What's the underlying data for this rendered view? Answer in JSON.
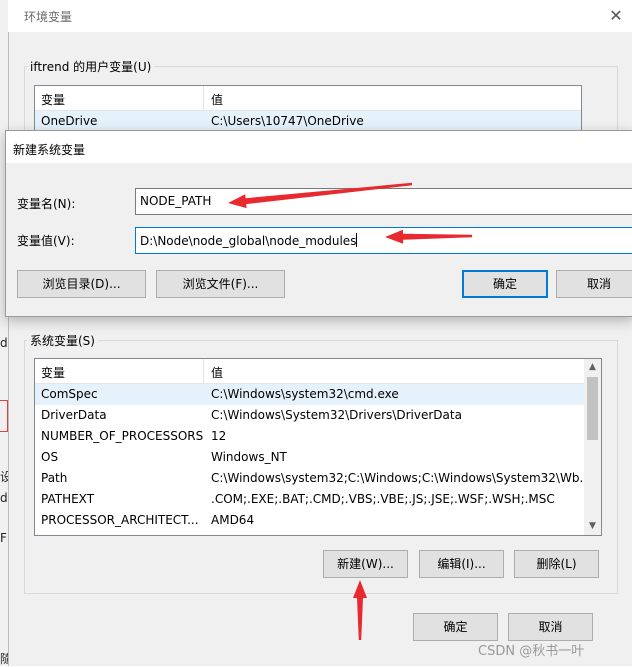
{
  "bg_window": {
    "letters": [
      "de",
      "设",
      "d",
      "F",
      "隨"
    ]
  },
  "env_dialog": {
    "title": "环境变量",
    "user_group_title": "iftrend 的用户变量(U)",
    "user_vars": {
      "headers": [
        "变量",
        "值"
      ],
      "rows": [
        {
          "name": "OneDrive",
          "value": "C:\\Users\\10747\\OneDrive"
        }
      ]
    },
    "system_group_title": "系统变量(S)",
    "system_vars": {
      "headers": [
        "变量",
        "值"
      ],
      "rows": [
        {
          "name": "ComSpec",
          "value": "C:\\Windows\\system32\\cmd.exe"
        },
        {
          "name": "DriverData",
          "value": "C:\\Windows\\System32\\Drivers\\DriverData"
        },
        {
          "name": "NUMBER_OF_PROCESSORS",
          "value": "12"
        },
        {
          "name": "OS",
          "value": "Windows_NT"
        },
        {
          "name": "Path",
          "value": "C:\\Windows\\system32;C:\\Windows;C:\\Windows\\System32\\Wb..."
        },
        {
          "name": "PATHEXT",
          "value": ".COM;.EXE;.BAT;.CMD;.VBS;.VBE;.JS;.JSE;.WSF;.WSH;.MSC"
        },
        {
          "name": "PROCESSOR_ARCHITECT...",
          "value": "AMD64"
        }
      ]
    },
    "buttons": {
      "new": "新建(W)...",
      "edit": "编辑(I)...",
      "delete": "删除(L)",
      "ok": "确定",
      "cancel": "取消"
    }
  },
  "new_var_dialog": {
    "title": "新建系统变量",
    "name_label": "变量名(N):",
    "name_value": "NODE_PATH",
    "value_label": "变量值(V):",
    "value_value": "D:\\Node\\node_global\\node_modules",
    "buttons": {
      "browse_dir": "浏览目录(D)...",
      "browse_file": "浏览文件(F)...",
      "ok": "确定",
      "cancel": "取消"
    }
  },
  "annotation_color": "#e8292f",
  "watermark": "CSDN @秋书一叶"
}
